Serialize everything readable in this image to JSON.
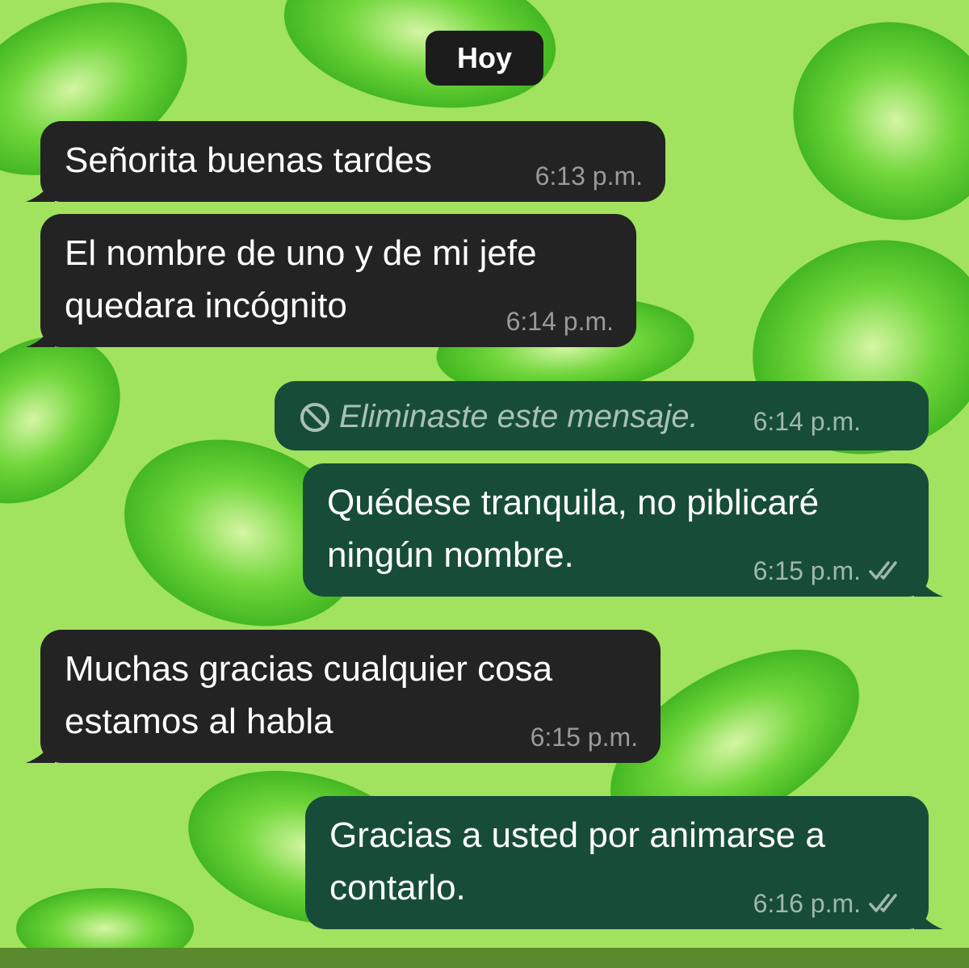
{
  "chat": {
    "date_label": "Hoy",
    "messages": [
      {
        "direction": "in",
        "text": "Señorita buenas tardes",
        "time": "6:13 p.m."
      },
      {
        "direction": "in",
        "text": "El nombre de uno y de mi jefe\nquedara incógnito",
        "time": "6:14 p.m."
      },
      {
        "direction": "out",
        "text": "Eliminaste este mensaje.",
        "time": "6:14 p.m.",
        "deleted": true
      },
      {
        "direction": "out",
        "text": "Quédese tranquila, no piblicaré\nningún nombre.",
        "time": "6:15 p.m.",
        "status": "read"
      },
      {
        "direction": "in",
        "text": "Muchas gracias cualquier cosa\nestamos al habla",
        "time": "6:15 p.m."
      },
      {
        "direction": "out",
        "text": "Gracias a usted por animarse a\ncontarlo.",
        "time": "6:16 p.m.",
        "status": "read"
      }
    ]
  },
  "icons": {
    "deleted": "ban-icon",
    "read_status": "double-check-icon"
  },
  "colors": {
    "wallpaper": "#a1e35e",
    "incoming_bubble": "#232323",
    "outgoing_bubble": "#174d38",
    "date_chip": "#1c1c1c"
  }
}
